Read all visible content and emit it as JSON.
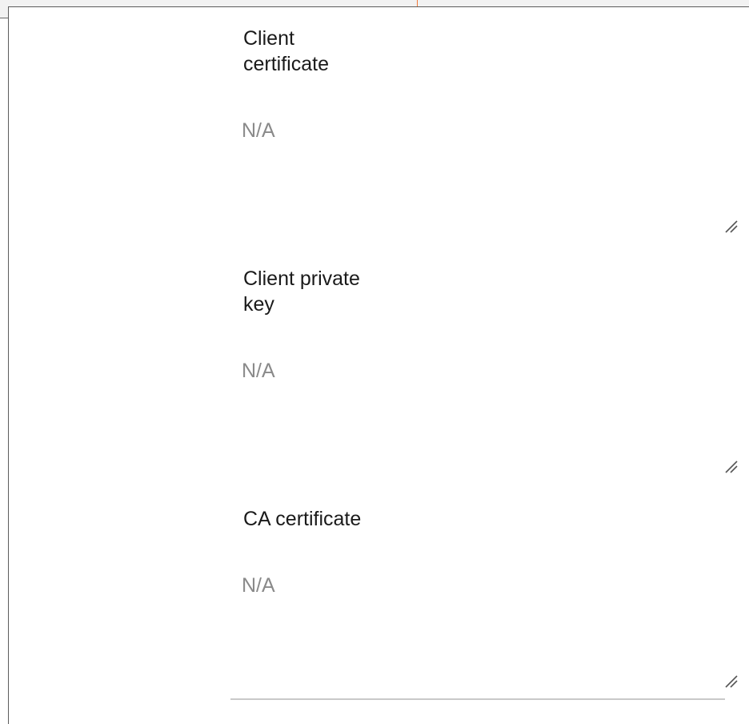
{
  "form": {
    "fields": [
      {
        "label": "Client certificate",
        "placeholder": "N/A"
      },
      {
        "label": "Client private key",
        "placeholder": "N/A"
      },
      {
        "label": "CA certificate",
        "placeholder": "N/A"
      }
    ]
  },
  "colors": {
    "label_text": "#1a1a1a",
    "placeholder_text": "#8a8a8a",
    "panel_border": "#5c5c5c",
    "underline": "#c9c9c9",
    "accent_tick": "#f07a3a"
  },
  "icons": {
    "resize_handle": "resize-grip-icon"
  }
}
